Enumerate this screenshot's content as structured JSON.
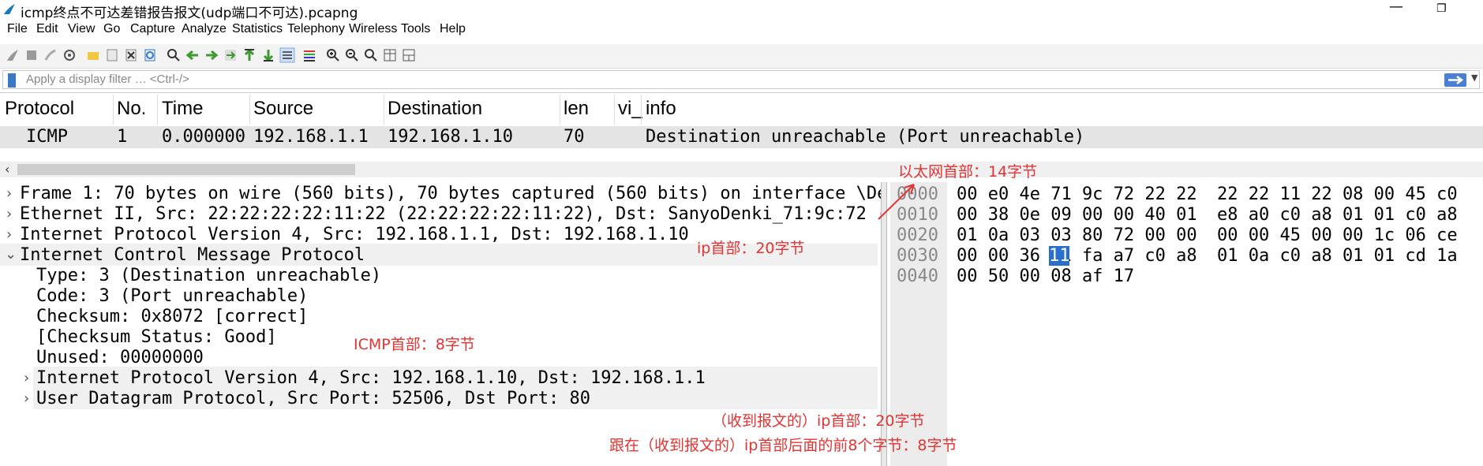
{
  "window": {
    "title": "icmp终点不可达差错报告报文(udp端口不可达).pcapng"
  },
  "menu": [
    "File",
    "Edit",
    "View",
    "Go",
    "Capture",
    "Analyze",
    "Statistics",
    "Telephony",
    "Wireless",
    "Tools",
    "Help"
  ],
  "toolbar": {
    "icons": [
      "shark-start-icon",
      "stop-icon",
      "restart-icon",
      "options-icon",
      "open-icon",
      "save-icon",
      "close-file-icon",
      "reload-icon",
      "find-icon",
      "back-icon",
      "forward-icon",
      "goto-icon",
      "first-icon",
      "last-icon",
      "autoscroll-icon",
      "colorize-icon",
      "zoom-in-icon",
      "zoom-out-icon",
      "zoom-reset-icon",
      "resize-columns-icon",
      "layout-icon"
    ]
  },
  "filter": {
    "placeholder": "Apply a display filter … <Ctrl-/>"
  },
  "packet_list": {
    "columns": [
      "Protocol",
      "No.",
      "Time",
      "Source",
      "Destination",
      "len",
      "vi_",
      "info"
    ],
    "rows": [
      {
        "protocol": "ICMP",
        "no": "1",
        "time": "0.000000",
        "source": "192.168.1.1",
        "destination": "192.168.1.10",
        "len": "70",
        "vi": "",
        "info": "Destination unreachable (Port unreachable)"
      }
    ]
  },
  "details": [
    {
      "text": "Frame 1: 70 bytes on wire (560 bits), 70 bytes captured (560 bits) on interface \\De",
      "expanded": false
    },
    {
      "text": "Ethernet II, Src: 22:22:22:22:11:22 (22:22:22:22:11:22), Dst: SanyoDenki_71:9c:72 (",
      "expanded": false
    },
    {
      "text": "Internet Protocol Version 4, Src: 192.168.1.1, Dst: 192.168.1.10",
      "expanded": false
    },
    {
      "text": "Internet Control Message Protocol",
      "expanded": true
    },
    {
      "text": "Type: 3 (Destination unreachable)"
    },
    {
      "text": "Code: 3 (Port unreachable)"
    },
    {
      "text": "Checksum: 0x8072 [correct]"
    },
    {
      "text": "[Checksum Status: Good]"
    },
    {
      "text": "Unused: 00000000"
    },
    {
      "text": "Internet Protocol Version 4, Src: 192.168.1.10, Dst: 192.168.1.1",
      "expanded": false
    },
    {
      "text": "User Datagram Protocol, Src Port: 52506, Dst Port: 80",
      "expanded": false
    }
  ],
  "bytes": {
    "offsets": [
      "0000",
      "0010",
      "0020",
      "0030",
      "0040"
    ],
    "rows": [
      [
        "00 e0 4e 71 9c 72 22 22",
        "22 22 11 22 08 00 45 c0"
      ],
      [
        "00 38 0e 09 00 00 40 01",
        "e8 a0 c0 a8 01 01 c0 a8"
      ],
      [
        "01 0a 03 03 80 72 00 00",
        "00 00 45 00 00 1c 06 ce"
      ],
      [
        "00 00 36 11 fa a7 c0 a8",
        "01 0a c0 a8 01 01 cd 1a"
      ],
      [
        "00 50 00 08 af 17",
        ""
      ]
    ],
    "selected_byte": "11"
  },
  "annotations": {
    "ethernet": "以太网首部：14字节",
    "ip": "ip首部：20字节",
    "icmp": "ICMP首部：8字节",
    "inner_ip": "（收到报文的）ip首部：20字节",
    "udp": "跟在（收到报文的）ip首部后面的前8个字节：8字节"
  },
  "colors": {
    "annotation": "#e53333",
    "selection": "#2a6fd0",
    "row_highlight": "#e4e4e4"
  }
}
